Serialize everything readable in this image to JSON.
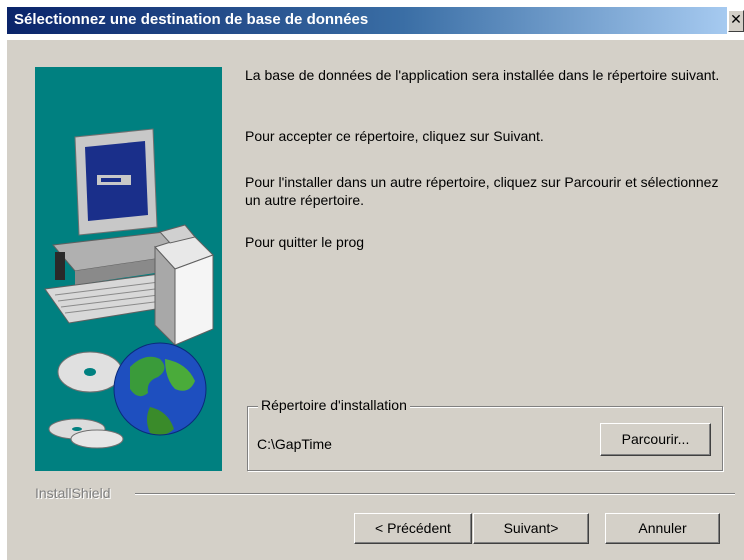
{
  "window": {
    "title": "Sélectionnez une destination de base de données",
    "close_glyph": "✕"
  },
  "body": {
    "paragraph1": "La base de données de l'application sera installée dans le répertoire suivant.",
    "paragraph2": "Pour accepter ce répertoire, cliquez sur Suivant.",
    "paragraph3": "Pour l'installer dans un autre répertoire, cliquez sur Parcourir et sélectionnez un autre répertoire.",
    "paragraph4": "Pour quitter le prog"
  },
  "install_group": {
    "label": "Répertoire d'installation",
    "path": "C:\\GapTime",
    "browse_label": "Parcourir..."
  },
  "footer": {
    "brand": "InstallShield",
    "back_label": "< Précédent",
    "next_label": "Suivant>",
    "cancel_label": "Annuler"
  },
  "colors": {
    "titlebar_start": "#0a246a",
    "titlebar_end": "#a6caf0",
    "side_panel": "#008080",
    "dialog_bg": "#d4d0c8"
  },
  "illustration": {
    "icons": [
      "computer-icon",
      "box-icon",
      "cd-icon",
      "globe-icon"
    ]
  }
}
